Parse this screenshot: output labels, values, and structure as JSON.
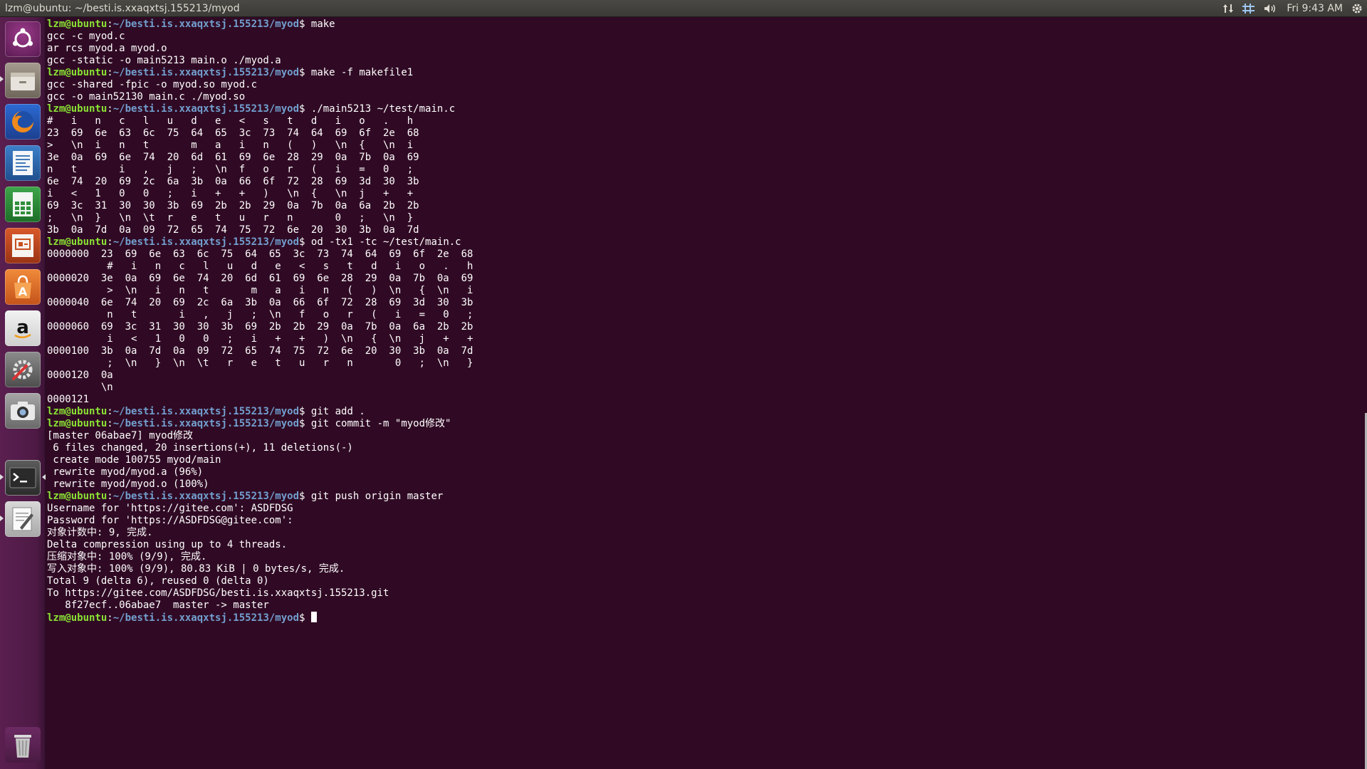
{
  "window_title": "lzm@ubuntu: ~/besti.is.xxaqxtsj.155213/myod",
  "indicators": {
    "network_icon": "network-updown-icon",
    "keyboard_icon": "keyboard-layout-icon",
    "sound_icon": "volume-icon",
    "clock": "Fri 9:43 AM",
    "session_icon": "gear-icon"
  },
  "launcher": [
    {
      "name": "dash-icon",
      "tooltip": ""
    },
    {
      "name": "files-icon",
      "tooltip": ""
    },
    {
      "name": "firefox-icon",
      "tooltip": ""
    },
    {
      "name": "writer-icon",
      "tooltip": ""
    },
    {
      "name": "calc-icon",
      "tooltip": ""
    },
    {
      "name": "impress-icon",
      "tooltip": ""
    },
    {
      "name": "software-center-icon",
      "tooltip": ""
    },
    {
      "name": "amazon-icon",
      "tooltip": ""
    },
    {
      "name": "system-settings-icon",
      "tooltip": ""
    },
    {
      "name": "camera-icon",
      "tooltip": ""
    },
    {
      "name": "terminal-icon",
      "tooltip": ""
    },
    {
      "name": "text-editor-icon",
      "tooltip": ""
    },
    {
      "name": "trash-icon",
      "tooltip": ""
    }
  ],
  "colors": {
    "terminal_bg": "#300a24",
    "prompt_user": "#8ae234",
    "prompt_path": "#729fcf",
    "text": "#ffffff"
  },
  "prompt": {
    "user": "lzm@ubuntu",
    "sep": ":",
    "path": "~/besti.is.xxaqxtsj.155213/myod",
    "sigil": "$ "
  },
  "terminal_lines": [
    {
      "cmd": "make"
    },
    {
      "out": "gcc -c myod.c"
    },
    {
      "out": "ar rcs myod.a myod.o"
    },
    {
      "out": "gcc -static -o main5213 main.o ./myod.a"
    },
    {
      "cmd": "make -f makefile1"
    },
    {
      "out": "gcc -shared -fpic -o myod.so myod.c"
    },
    {
      "out": "gcc -o main52130 main.c ./myod.so"
    },
    {
      "cmd": "./main5213 ~/test/main.c"
    },
    {
      "out": "#   i   n   c   l   u   d   e   <   s   t   d   i   o   .   h"
    },
    {
      "out": "23  69  6e  63  6c  75  64  65  3c  73  74  64  69  6f  2e  68"
    },
    {
      "out": ">   \\n  i   n   t       m   a   i   n   (   )   \\n  {   \\n  i"
    },
    {
      "out": "3e  0a  69  6e  74  20  6d  61  69  6e  28  29  0a  7b  0a  69"
    },
    {
      "out": "n   t       i   ,   j   ;   \\n  f   o   r   (   i   =   0   ;"
    },
    {
      "out": "6e  74  20  69  2c  6a  3b  0a  66  6f  72  28  69  3d  30  3b"
    },
    {
      "out": "i   <   1   0   0   ;   i   +   +   )   \\n  {   \\n  j   +   +"
    },
    {
      "out": "69  3c  31  30  30  3b  69  2b  2b  29  0a  7b  0a  6a  2b  2b"
    },
    {
      "out": ";   \\n  }   \\n  \\t  r   e   t   u   r   n       0   ;   \\n  }"
    },
    {
      "out": "3b  0a  7d  0a  09  72  65  74  75  72  6e  20  30  3b  0a  7d"
    },
    {
      "cmd": "od -tx1 -tc ~/test/main.c"
    },
    {
      "out": "0000000  23  69  6e  63  6c  75  64  65  3c  73  74  64  69  6f  2e  68"
    },
    {
      "out": "          #   i   n   c   l   u   d   e   <   s   t   d   i   o   .   h"
    },
    {
      "out": "0000020  3e  0a  69  6e  74  20  6d  61  69  6e  28  29  0a  7b  0a  69"
    },
    {
      "out": "          >  \\n   i   n   t       m   a   i   n   (   )  \\n   {  \\n   i"
    },
    {
      "out": "0000040  6e  74  20  69  2c  6a  3b  0a  66  6f  72  28  69  3d  30  3b"
    },
    {
      "out": "          n   t       i   ,   j   ;  \\n   f   o   r   (   i   =   0   ;"
    },
    {
      "out": "0000060  69  3c  31  30  30  3b  69  2b  2b  29  0a  7b  0a  6a  2b  2b"
    },
    {
      "out": "          i   <   1   0   0   ;   i   +   +   )  \\n   {  \\n   j   +   +"
    },
    {
      "out": "0000100  3b  0a  7d  0a  09  72  65  74  75  72  6e  20  30  3b  0a  7d"
    },
    {
      "out": "          ;  \\n   }  \\n  \\t   r   e   t   u   r   n       0   ;  \\n   }"
    },
    {
      "out": "0000120  0a"
    },
    {
      "out": "         \\n"
    },
    {
      "out": "0000121"
    },
    {
      "cmd": "git add ."
    },
    {
      "cmd": "git commit -m \"myod修改\""
    },
    {
      "out": "[master 06abae7] myod修改"
    },
    {
      "out": " 6 files changed, 20 insertions(+), 11 deletions(-)"
    },
    {
      "out": " create mode 100755 myod/main"
    },
    {
      "out": " rewrite myod/myod.a (96%)"
    },
    {
      "out": " rewrite myod/myod.o (100%)"
    },
    {
      "cmd": "git push origin master"
    },
    {
      "out": "Username for 'https://gitee.com': ASDFDSG"
    },
    {
      "out": "Password for 'https://ASDFDSG@gitee.com':"
    },
    {
      "out": "对象计数中: 9, 完成."
    },
    {
      "out": "Delta compression using up to 4 threads."
    },
    {
      "out": "压缩对象中: 100% (9/9), 完成."
    },
    {
      "out": "写入对象中: 100% (9/9), 80.83 KiB | 0 bytes/s, 完成."
    },
    {
      "out": "Total 9 (delta 6), reused 0 (delta 0)"
    },
    {
      "out": "To https://gitee.com/ASDFDSG/besti.is.xxaqxtsj.155213.git"
    },
    {
      "out": "   8f27ecf..06abae7  master -> master"
    },
    {
      "cmd": "",
      "cursor": true
    }
  ]
}
